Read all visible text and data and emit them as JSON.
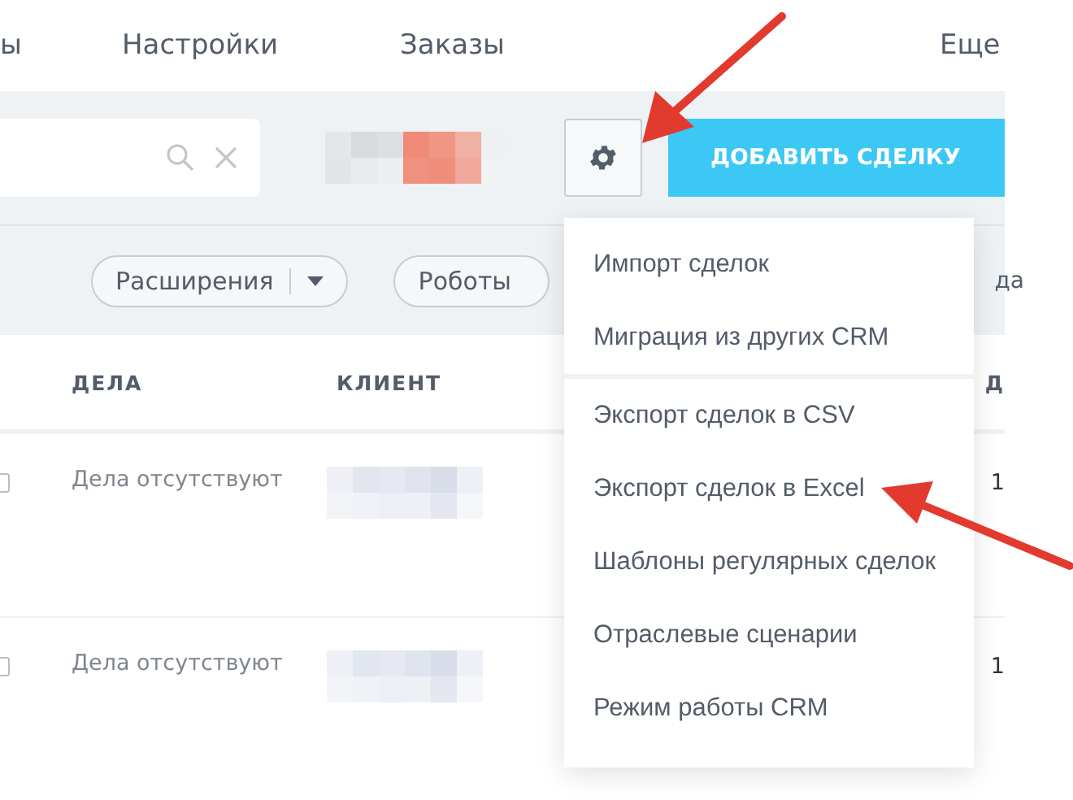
{
  "nav": {
    "items": [
      {
        "label": "ы"
      },
      {
        "label": "Настройки"
      },
      {
        "label": "Заказы"
      },
      {
        "label": "Еще"
      }
    ]
  },
  "toolbar": {
    "add_button": "ДОБАВИТЬ СДЕЛКУ"
  },
  "filters": {
    "buttons": [
      {
        "label": "Расширения",
        "kind": "dropdown"
      },
      {
        "label": "Роботы",
        "kind": "plain"
      }
    ],
    "cut_text": "да"
  },
  "table": {
    "columns": [
      "ДЕЛА",
      "КЛИЕНТ",
      "Д"
    ],
    "rows": [
      {
        "checked": false,
        "activities": "Дела отсутствуют",
        "column_3": "1"
      },
      {
        "checked": false,
        "activities": "Дела отсутствуют",
        "column_3": "1"
      }
    ]
  },
  "settings_menu": {
    "open": true,
    "groups": [
      {
        "items": [
          "Импорт сделок",
          "Миграция из других CRM"
        ]
      },
      {
        "items": [
          "Экспорт сделок в CSV",
          "Экспорт сделок в Excel",
          "Шаблоны регулярных сделок",
          "Отраслевые сценарии",
          "Режим работы CRM"
        ]
      }
    ]
  }
}
